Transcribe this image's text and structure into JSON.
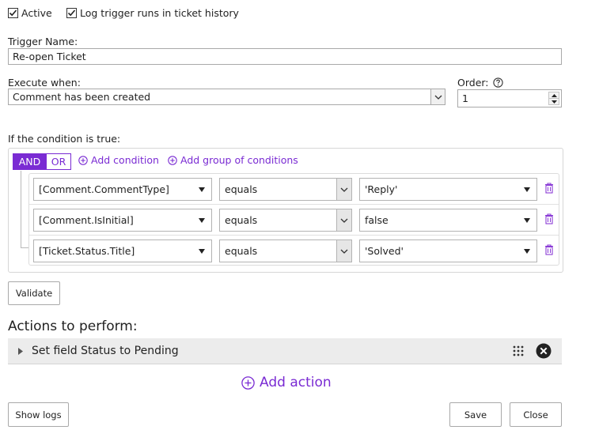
{
  "options": {
    "active_label": "Active",
    "active_checked": true,
    "log_label": "Log trigger runs in ticket history",
    "log_checked": true
  },
  "trigger_name": {
    "label": "Trigger Name:",
    "value": "Re-open Ticket"
  },
  "execute_when": {
    "label": "Execute when:",
    "value": "Comment has been created"
  },
  "order": {
    "label": "Order:",
    "value": "1",
    "help_icon": "question-circle-icon"
  },
  "conditions": {
    "heading": "If the condition is true:",
    "and_label": "AND",
    "or_label": "OR",
    "selected_logic": "AND",
    "add_condition_label": "Add condition",
    "add_group_label": "Add group of conditions",
    "rows": [
      {
        "field": "[Comment.CommentType]",
        "operator": "equals",
        "value": "'Reply'"
      },
      {
        "field": "[Comment.IsInitial]",
        "operator": "equals",
        "value": "false"
      },
      {
        "field": "[Ticket.Status.Title]",
        "operator": "equals",
        "value": "'Solved'"
      }
    ]
  },
  "validate_label": "Validate",
  "actions": {
    "heading": "Actions to perform:",
    "items": [
      {
        "label": "Set field Status to Pending"
      }
    ],
    "add_action_label": "Add action"
  },
  "footer": {
    "show_logs_label": "Show logs",
    "save_label": "Save",
    "close_label": "Close"
  },
  "colors": {
    "accent": "#7a2bd3",
    "and_active_bg": "#7a2bd3"
  }
}
